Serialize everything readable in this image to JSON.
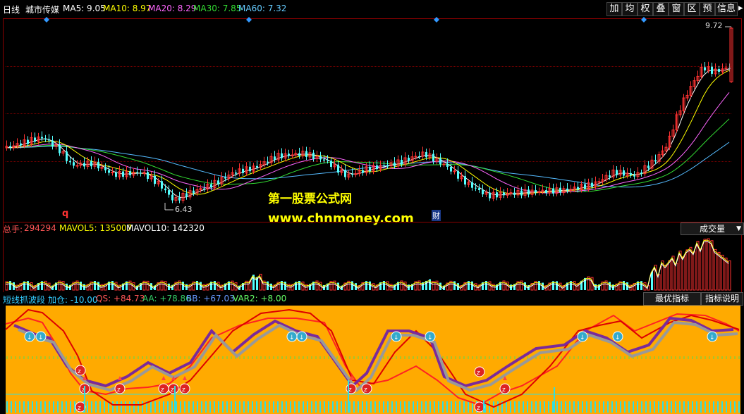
{
  "top": {
    "period": "日线",
    "name": "城市传媒",
    "ma": [
      {
        "label": "MA5: 9.05",
        "color": "#ffffff"
      },
      {
        "label": "MA10: 8.97",
        "color": "#ffff00"
      },
      {
        "label": "MA20: 8.29",
        "color": "#ff66ff"
      },
      {
        "label": "MA30: 7.85",
        "color": "#33dd33"
      },
      {
        "label": "MA60: 7.32",
        "color": "#66ccff"
      }
    ],
    "toolbar": [
      "加",
      "均",
      "权",
      "叠",
      "窗",
      "区",
      "预",
      "信息"
    ]
  },
  "price": {
    "high_label": "9.72",
    "low_label": "6.43",
    "q_marker": "q",
    "cai_marker": "财"
  },
  "volume": {
    "total_label": "总手: ",
    "total_value": "294294",
    "mavol5": "MAVOL5: 135007",
    "mavol10": "MAVOL10: 142320",
    "selector": "成交量"
  },
  "indicator": {
    "name": "短线抓波段",
    "jiacang": "加仓: -10.00",
    "qs": "QS: +84.73",
    "aa": "AA: +78.86",
    "bb": "BB: +67.03",
    "var2": "VAR2: +8.00",
    "btn_best": "最优指标",
    "btn_explain": "指标说明"
  },
  "watermark": {
    "line1": "第一股票公式网",
    "line2": "www.chnmoney.com"
  },
  "colors": {
    "up": "#ff3232",
    "down": "#54ffff",
    "indicator_bg": "#ffaa00"
  }
}
